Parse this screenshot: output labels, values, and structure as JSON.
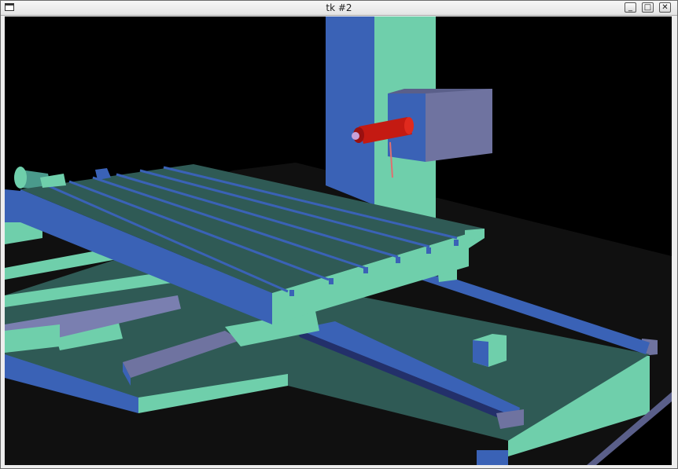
{
  "window": {
    "title": "tk #2",
    "controls": {
      "minimize": "_",
      "maximize": "□",
      "close": "✕"
    }
  },
  "icons": {
    "window_menu": "window-icon"
  },
  "colors": {
    "background": "#000000",
    "mint": "#6fcfab",
    "blue": "#3860b0",
    "teal_dark": "#2f5a55",
    "slate": "#6f73a0",
    "spindle_red": "#cc1a10"
  }
}
